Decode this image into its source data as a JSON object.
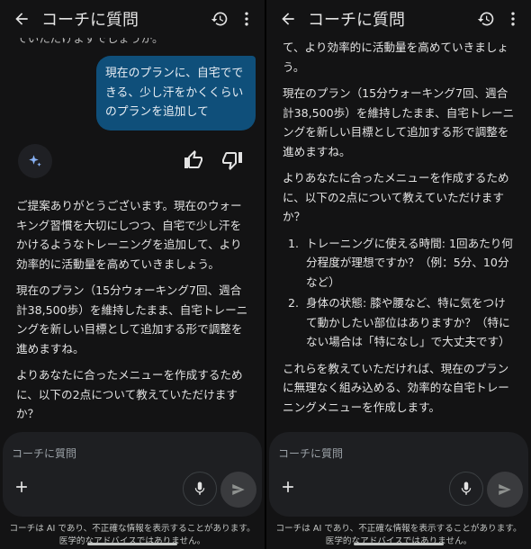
{
  "header": {
    "title": "コーチに質問"
  },
  "left": {
    "top_cut_text": "ていただけますでしょうか。",
    "user_message": "現在のプランに、自宅でできる、少し汗をかくくらいのプランを追加して",
    "ai_paragraphs": [
      "ご提案ありがとうございます。現在のウォーキング習慣を大切にしつつ、自宅で少し汗をかけるようなトレーニングを追加して、より効率的に活動量を高めていきましょう。",
      "現在のプラン（15分ウォーキング7回、週合計38,500歩）を維持したまま、自宅トレーニングを新しい目標として追加する形で調整を進めますね。",
      "よりあなたに合ったメニューを作成するために、以下の2点について教えていただけますか？"
    ]
  },
  "right": {
    "paragraphs": [
      "て、より効率的に活動量を高めていきましょう。",
      "現在のプラン（15分ウォーキング7回、週合計38,500歩）を維持したまま、自宅トレーニングを新しい目標として追加する形で調整を進めますね。",
      "よりあなたに合ったメニューを作成するために、以下の2点について教えていただけますか？"
    ],
    "list": [
      {
        "num": "1.",
        "text": "トレーニングに使える時間: 1回あたり何分程度が理想ですか？（例：5分、10分など）"
      },
      {
        "num": "2.",
        "text": "身体の状態: 膝や腰など、特に気をつけて動かしたい部位はありますか？（特にない場合は「特になし」で大丈夫です）"
      }
    ],
    "closing": "これらを教えていただければ、現在のプランに無理なく組み込める、効率的な自宅トレーニングメニューを作成します。"
  },
  "input": {
    "placeholder": "コーチに質問"
  },
  "disclaimer": "コーチは AI であり、不正確な情報を表示することがあります。医学的なアドバイスではありません。",
  "icons": {
    "back": "arrow-left-icon",
    "history": "history-icon",
    "more": "more-vert-icon",
    "spark": "sparkle-icon",
    "like": "thumb-up-icon",
    "dislike": "thumb-down-icon",
    "add": "plus-icon",
    "mic": "mic-icon",
    "send": "send-icon"
  },
  "colors": {
    "background": "#131314",
    "user_bubble": "#0f4f7a",
    "input_box": "#1e1f22"
  }
}
